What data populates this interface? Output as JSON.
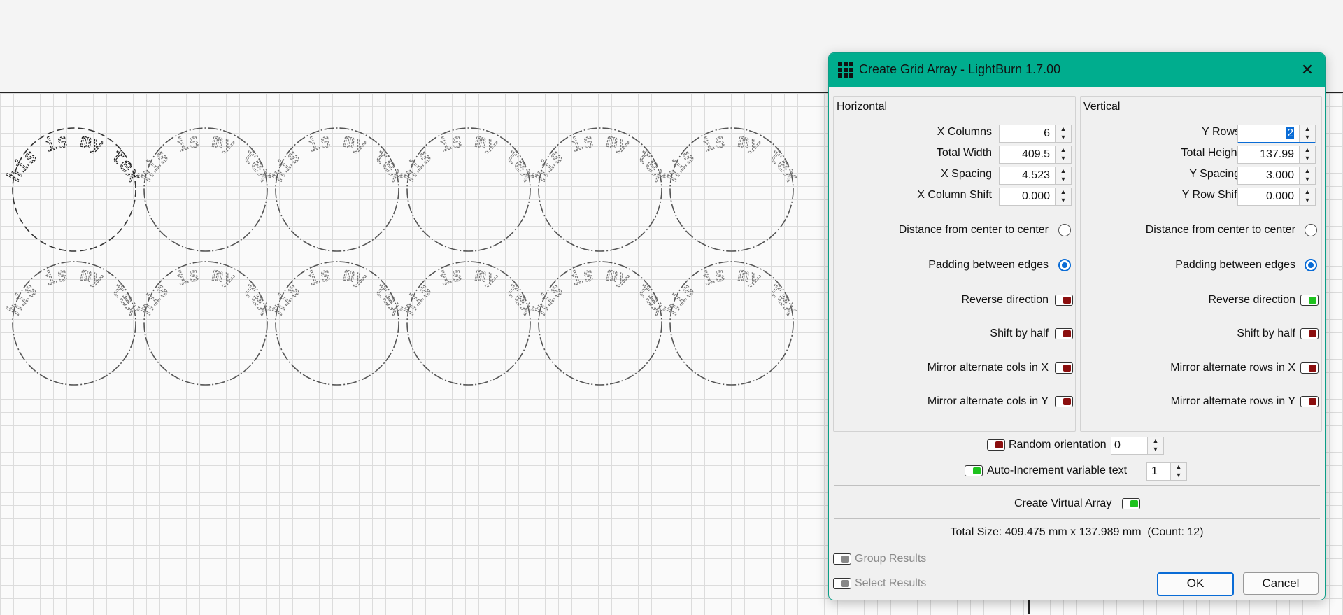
{
  "dialog": {
    "title": "Create Grid Array - LightBurn 1.7.00",
    "close_label": "✕"
  },
  "horizontal": {
    "group_title": "Horizontal",
    "x_columns": {
      "label": "X Columns",
      "value": "6"
    },
    "total_width": {
      "label": "Total Width",
      "value": "409.5"
    },
    "x_spacing": {
      "label": "X Spacing",
      "value": "4.523"
    },
    "x_column_shift": {
      "label": "X Column Shift",
      "value": "0.000"
    },
    "distance_center": {
      "label": "Distance from center to center",
      "selected": false
    },
    "padding_edges": {
      "label": "Padding between edges",
      "selected": true
    },
    "reverse_direction": {
      "label": "Reverse direction",
      "on": false
    },
    "shift_by_half": {
      "label": "Shift by half",
      "on": false
    },
    "mirror_x": {
      "label": "Mirror alternate cols in X",
      "on": false
    },
    "mirror_y": {
      "label": "Mirror alternate cols in Y",
      "on": false
    }
  },
  "vertical": {
    "group_title": "Vertical",
    "y_rows": {
      "label": "Y Rows",
      "value": "2"
    },
    "total_height": {
      "label": "Total Height",
      "value": "137.99"
    },
    "y_spacing": {
      "label": "Y Spacing",
      "value": "3.000"
    },
    "y_row_shift": {
      "label": "Y Row Shift",
      "value": "0.000"
    },
    "distance_center": {
      "label": "Distance from center to center",
      "selected": false
    },
    "padding_edges": {
      "label": "Padding between edges",
      "selected": true
    },
    "reverse_direction": {
      "label": "Reverse direction",
      "on": true
    },
    "shift_by_half": {
      "label": "Shift by half",
      "on": false
    },
    "mirror_x": {
      "label": "Mirror alternate rows in X",
      "on": false
    },
    "mirror_y": {
      "label": "Mirror alternate rows in Y",
      "on": false
    }
  },
  "random_orientation": {
    "label": "Random orientation",
    "value": "0",
    "on": false
  },
  "auto_increment": {
    "label": "Auto-Increment variable text",
    "value": "1",
    "on": true
  },
  "virtual_array": {
    "label": "Create Virtual Array",
    "on": true
  },
  "total_size": "Total Size: 409.475 mm x 137.989 mm  (Count: 12)",
  "group_results": {
    "label": "Group Results",
    "enabled": false
  },
  "select_results": {
    "label": "Select Results",
    "enabled": false
  },
  "buttons": {
    "ok": "OK",
    "cancel": "Cancel"
  },
  "design": {
    "item_text": "This is my text",
    "columns": 6,
    "rows": 2
  },
  "colors": {
    "accent": "#00ad8e",
    "selection": "#0a6cd6",
    "toggle_off": "#8b0e0e",
    "toggle_on": "#1ec21e"
  }
}
